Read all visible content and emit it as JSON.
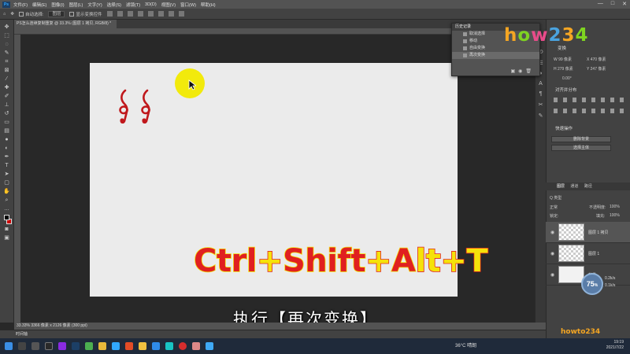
{
  "menubar": {
    "logo": "Ps",
    "items": [
      "文件(F)",
      "编辑(E)",
      "图像(I)",
      "图层(L)",
      "文字(Y)",
      "选择(S)",
      "滤镜(T)",
      "3D(D)",
      "视图(V)",
      "窗口(W)",
      "帮助(H)"
    ],
    "window_controls": [
      "—",
      "□",
      "✕"
    ]
  },
  "options_bar": {
    "auto_select_label": "自动选择:",
    "auto_select_value": "图层",
    "show_transform_label": "显示变换控件"
  },
  "document_tab": "PS怎么连续复制重复 @ 33.3% (图层 1 拷贝, RGB/8) *",
  "status_bar": "33.33%   3366 像素 x 2126 像素 (300 ppi)",
  "timeline_tab": "时间轴",
  "history_panel": {
    "title": "历史记录",
    "items": [
      "取消选择",
      "移动",
      "自由变换",
      "再次变换"
    ],
    "active_index": 3
  },
  "properties_panel": {
    "transform_title": "变换",
    "w": "W  99 像素",
    "x": "X  470 像素",
    "h": "H  279 像素",
    "y": "Y  247 像素",
    "angle": "0.00°",
    "align_title": "对齐并分布",
    "quick_actions_title": "快速操作",
    "btn_remove_bg": "删除背景",
    "btn_select_subject": "选择主体"
  },
  "layers_panel": {
    "tabs": [
      "图层",
      "通道",
      "路径"
    ],
    "active_tab": 0,
    "kind_label": "Q 类型",
    "mode_label": "正常",
    "opacity_label": "不透明度:",
    "opacity_value": "100%",
    "lock_label": "锁定:",
    "fill_label": "填充:",
    "fill_value": "100%",
    "layers": [
      {
        "name": "图层 1 拷贝",
        "selected": true,
        "thumb": "transparent"
      },
      {
        "name": "图层 1",
        "selected": false,
        "thumb": "transparent"
      },
      {
        "name": "背景",
        "selected": false,
        "thumb": "white"
      }
    ]
  },
  "canvas": {
    "clef_symbols": "𝄞 𝄞",
    "shortcut_parts": [
      "C",
      "t",
      "r",
      "l",
      "+",
      "S",
      "h",
      "i",
      "f",
      "t",
      "+",
      "A",
      "l",
      "t",
      "+",
      "T"
    ],
    "subtitle": "执行【再次变换】"
  },
  "overlay": {
    "watermark_parts": [
      "h",
      "o",
      "w",
      "2",
      "3",
      "4"
    ],
    "watermark_small": "howto234",
    "gauge_value": "75",
    "gauge_unit": "%",
    "net_up": "0.2k/s",
    "net_down": "0.1k/s"
  },
  "taskbar": {
    "weather": "36°C 晴朗",
    "time": "19:19",
    "date": "2021/7/22"
  },
  "colors": {
    "shortcut_red": "#e02020",
    "shortcut_yellow": "#f5e20a",
    "cursor_highlight": "#f2ea0c",
    "artboard": "#ebebeb"
  }
}
